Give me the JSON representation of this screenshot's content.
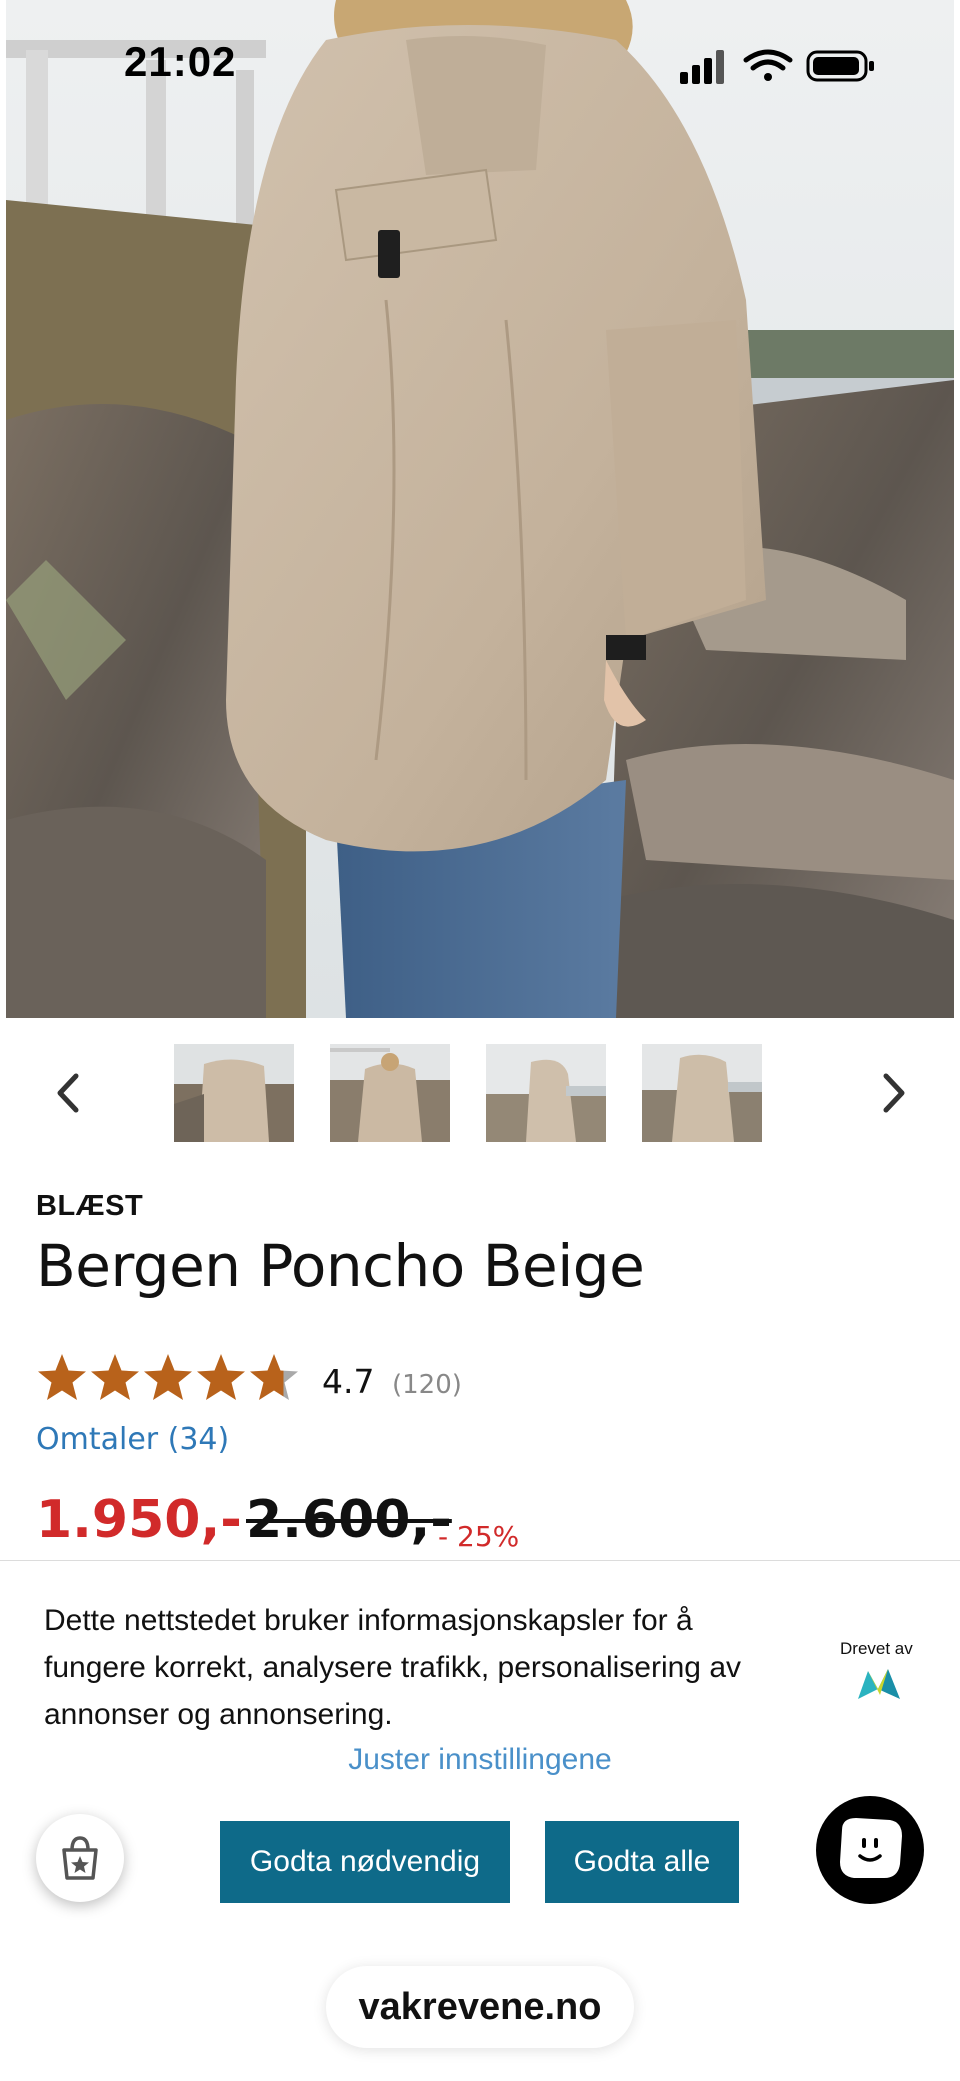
{
  "status_bar": {
    "time": "21:02"
  },
  "icons": {
    "signal": "signal-icon",
    "wifi": "wifi-icon",
    "battery": "battery-icon",
    "prev": "chevron-left-icon",
    "next": "chevron-right-icon",
    "bag": "shopping-bag-icon",
    "chat": "chat-smiley-icon"
  },
  "product": {
    "brand": "BLÆST",
    "title": "Bergen Poncho Beige",
    "rating": {
      "value": "4.7",
      "count": "(120)",
      "stars": 4.7,
      "max": 5
    },
    "reviews_link": "Omtaler (34)",
    "price": "1.950,-",
    "old_price": "2.600,-",
    "discount": "- 25%"
  },
  "cookie_banner": {
    "text": "Dette nettstedet bruker informasjonskapsler for å fungere korrekt, analysere trafikk, personalisering av annonser og annonsering.",
    "powered_by": "Drevet av",
    "settings_link": "Juster innstillingene",
    "accept_necessary": "Godta nødvendig",
    "accept_all": "Godta alle"
  },
  "browser": {
    "url": "vakrevene.no"
  },
  "colors": {
    "price_red": "#d12a2a",
    "star_orange": "#b8621b",
    "link_blue": "#2e78b7",
    "button_teal": "#0e6a89",
    "poncho_beige": "#c9b8a3"
  }
}
